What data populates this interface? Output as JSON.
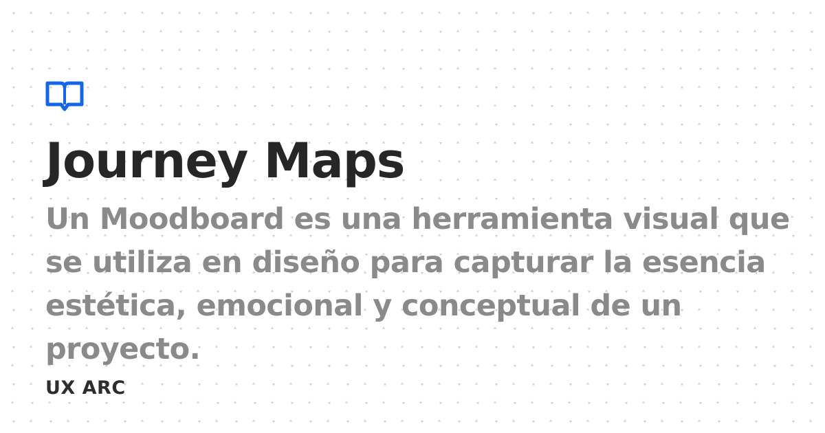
{
  "logo": {
    "icon": "open-book-icon",
    "color": "#1466e6"
  },
  "title": "Journey Maps",
  "description": "Un Moodboard es una herramienta visual que se utiliza en diseño para capturar la esencia estética, emocional y conceptual de un proyecto.",
  "brand": "UX ARC",
  "colors": {
    "background": "#ffffff",
    "title": "#262626",
    "description": "#8a8a8a",
    "brand": "#2d2d2d",
    "pattern": "#cfcfcf"
  }
}
